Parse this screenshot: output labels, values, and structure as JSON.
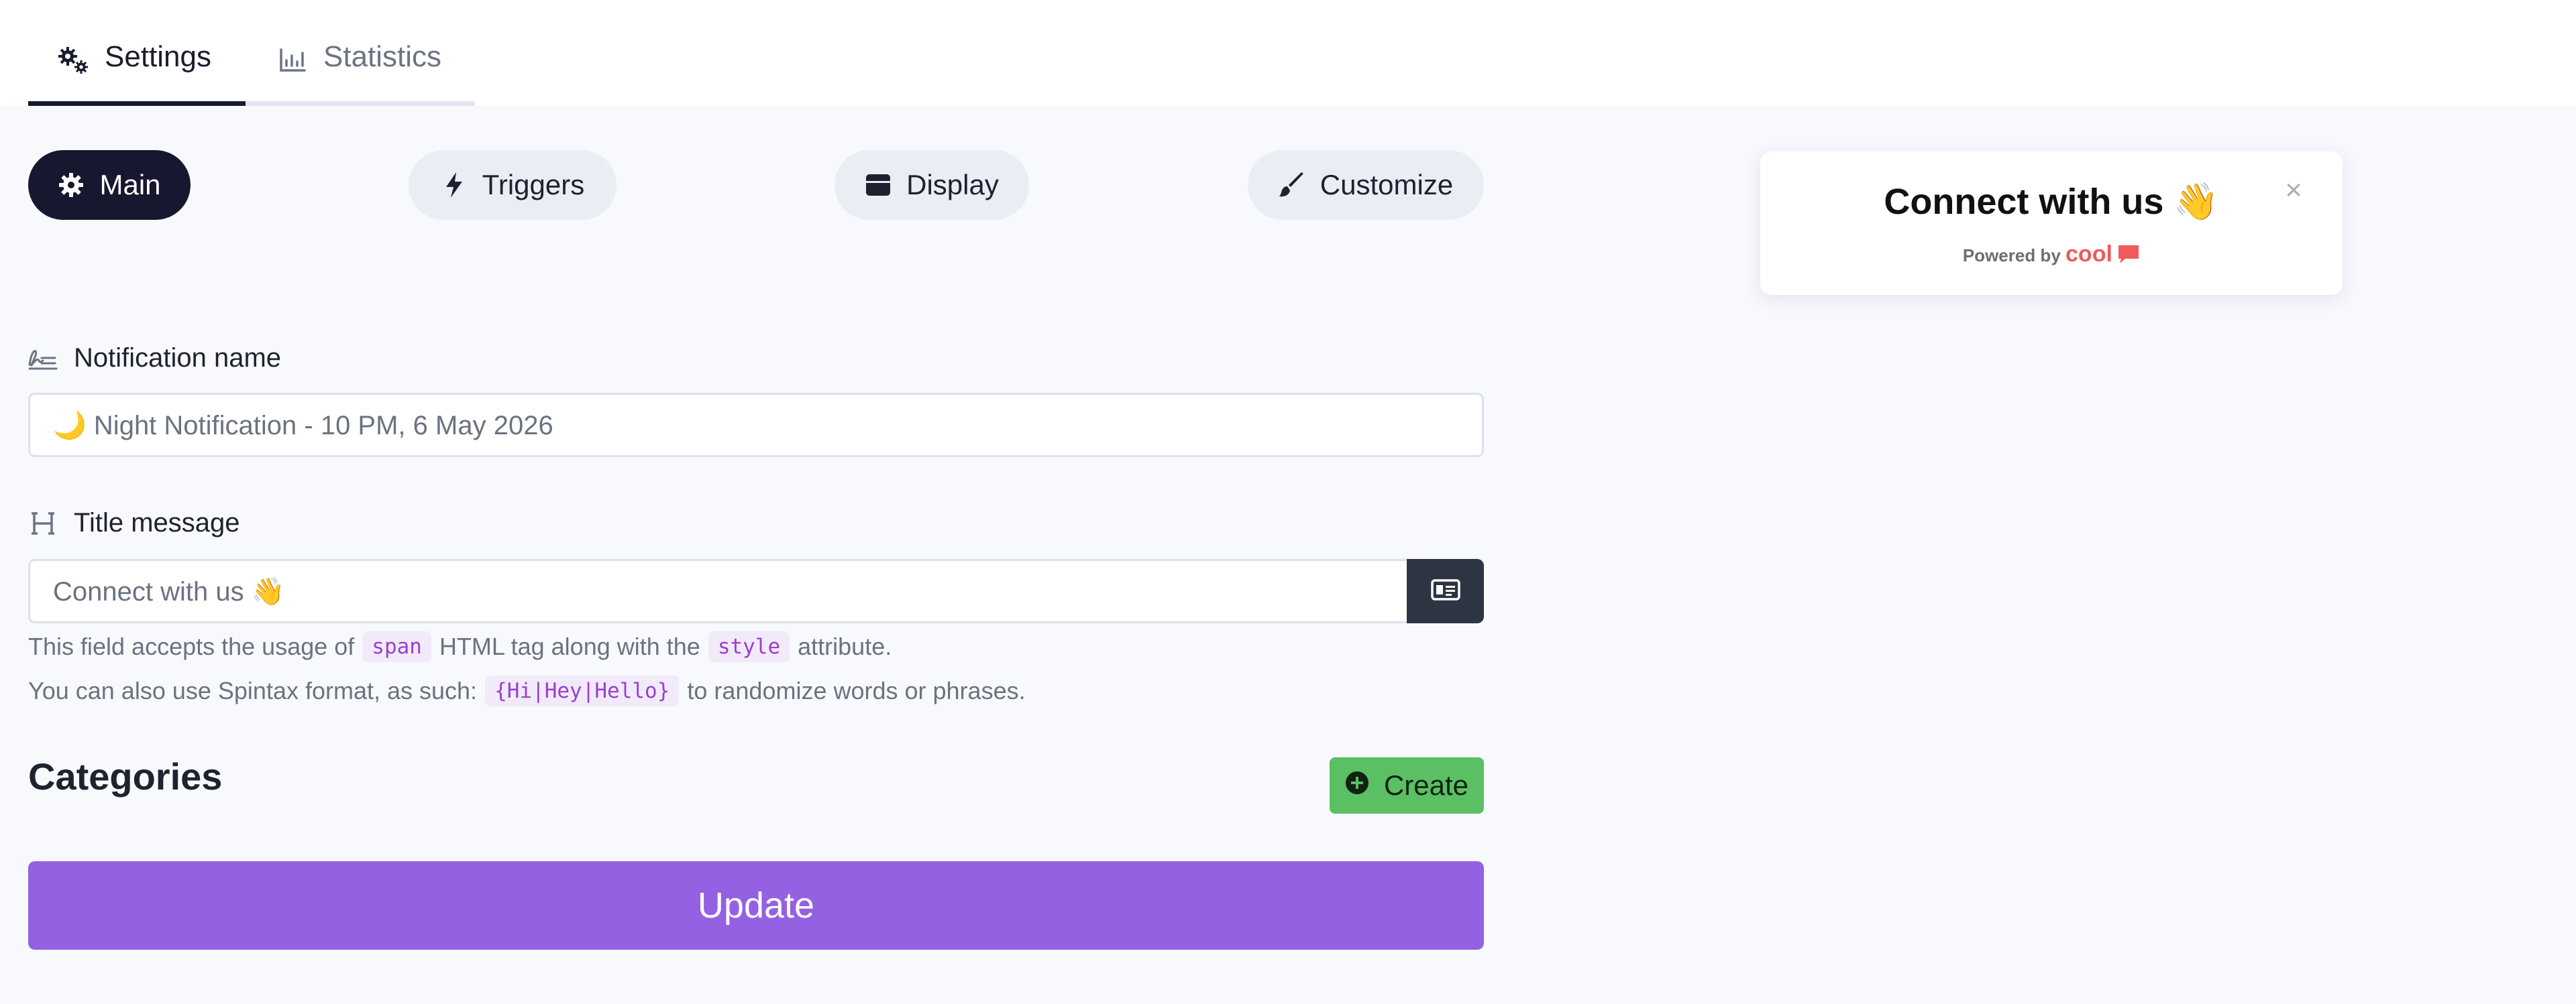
{
  "tabs": {
    "settings": "Settings",
    "statistics": "Statistics"
  },
  "sections": {
    "main": "Main",
    "triggers": "Triggers",
    "display": "Display",
    "customize": "Customize"
  },
  "form": {
    "notification_name_label": "Notification name",
    "notification_name_value": "🌙 Night Notification - 10 PM, 6 May 2026",
    "title_message_label": "Title message",
    "title_message_value": "Connect with us 👋",
    "help_line1_a": "This field accepts the usage of",
    "help_line1_code1": "span",
    "help_line1_b": "HTML tag along with the",
    "help_line1_code2": "style",
    "help_line1_c": "attribute.",
    "help_line2_a": "You can also use Spintax format, as such:",
    "help_line2_code": "{Hi|Hey|Hello}",
    "help_line2_b": "to randomize words or phrases."
  },
  "categories": {
    "title": "Categories",
    "create_label": "Create"
  },
  "update_label": "Update",
  "preview": {
    "title": "Connect with us 👋",
    "powered_by": "Powered by",
    "brand": "cool",
    "close": "×"
  },
  "colors": {
    "accent": "#9461e2",
    "dark": "#181730",
    "create": "#5bbf63"
  },
  "icons": {
    "settings_tab": "cogs-icon",
    "statistics_tab": "bar-chart-icon",
    "main": "gear-icon",
    "triggers": "bolt-icon",
    "display": "window-icon",
    "customize": "brush-icon",
    "name_label": "signature-icon",
    "title_label": "heading-icon",
    "title_button": "id-card-icon",
    "create": "plus-circle-icon",
    "close": "close-icon"
  }
}
